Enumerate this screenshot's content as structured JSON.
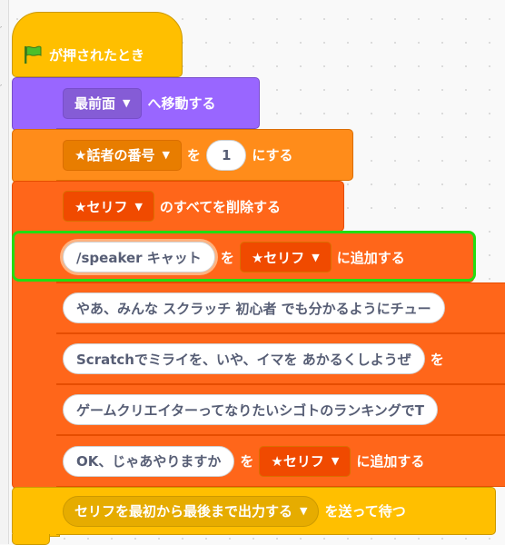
{
  "hat": {
    "label": "が押されたとき",
    "icon": "green-flag-icon"
  },
  "go_to_layer": {
    "menu": "最前面",
    "label": "へ移動する"
  },
  "set_var": {
    "var": "★話者の番号",
    "to_label": "を",
    "value": "1",
    "suffix": "にする"
  },
  "delete_all": {
    "list": "★セリフ",
    "label": "のすべてを削除する"
  },
  "add_list": [
    {
      "item": "/speaker キャット",
      "to_label": "を",
      "list": "★セリフ",
      "suffix": "に追加する"
    },
    {
      "item": "やあ、みんな スクラッチ 初心者 でも分かるようにチュー"
    },
    {
      "item": "Scratchでミライを、いや、イマを あかるくしようぜ",
      "to_label": "を"
    },
    {
      "item": "ゲームクリエイターってなりたいシゴトのランキングでT"
    },
    {
      "item": "OK、じゃあやりますか",
      "to_label": "を",
      "list": "★セリフ",
      "suffix": "に追加する"
    }
  ],
  "broadcast": {
    "message": "セリフを最初から最後まで出力する",
    "label": "を送って待つ"
  },
  "colors": {
    "event": "#ffbf00",
    "looks": "#9966ff",
    "variables": "#ff8c1a",
    "list": "#ff661a",
    "highlight": "#22dd11"
  }
}
